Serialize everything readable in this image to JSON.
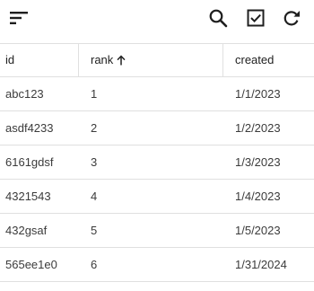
{
  "toolbar": {
    "icons": [
      "sort-icon",
      "search-icon",
      "checkbox-icon",
      "refresh-icon"
    ],
    "icon_color": "#1f1f1f"
  },
  "table": {
    "columns": [
      {
        "label": "id"
      },
      {
        "label": "rank",
        "sort": "ascending",
        "sort_icon": "arrow-up-icon"
      },
      {
        "label": "created"
      }
    ],
    "rows": [
      {
        "id": "abc123",
        "rank": "1",
        "created": "1/1/2023"
      },
      {
        "id": "asdf4233",
        "rank": "2",
        "created": "1/2/2023"
      },
      {
        "id": "6161gdsf",
        "rank": "3",
        "created": "1/3/2023"
      },
      {
        "id": "4321543",
        "rank": "4",
        "created": "1/4/2023"
      },
      {
        "id": "432gsaf",
        "rank": "5",
        "created": "1/5/2023"
      },
      {
        "id": "565ee1e0",
        "rank": "6",
        "created": "1/31/2024"
      }
    ],
    "border_color": "#e0e0e0"
  }
}
